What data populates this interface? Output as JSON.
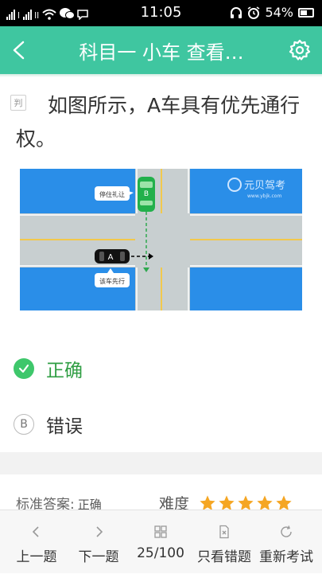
{
  "status_bar": {
    "time": "11:05",
    "battery": "54%",
    "sim1_label": "l",
    "sim2_label": "ll"
  },
  "header": {
    "title": "科目一 小车 查看…"
  },
  "question": {
    "type_badge": "判",
    "text": "如图所示，A车具有优先通行权。",
    "image": {
      "car_b_label": "B",
      "car_a_label": "A",
      "bubble_b": "停住礼让",
      "bubble_a": "该车先行",
      "watermark_name": "元贝驾考",
      "watermark_url": "www.ybjk.com"
    }
  },
  "options": [
    {
      "marker": "✓",
      "label": "正确",
      "selected": true
    },
    {
      "marker": "B",
      "label": "错误",
      "selected": false
    }
  ],
  "answer": {
    "label": "标准答案:",
    "value": "正确"
  },
  "difficulty": {
    "label": "难度",
    "stars": 5
  },
  "bottom_bar": {
    "prev": "上一题",
    "next": "下一题",
    "progress": "25/100",
    "wrong_only": "只看错题",
    "retake": "重新考试"
  },
  "colors": {
    "header": "#3fc6a0",
    "correct": "#3ec76b",
    "star": "#f5a623",
    "road_blue": "#2a8ee8"
  }
}
